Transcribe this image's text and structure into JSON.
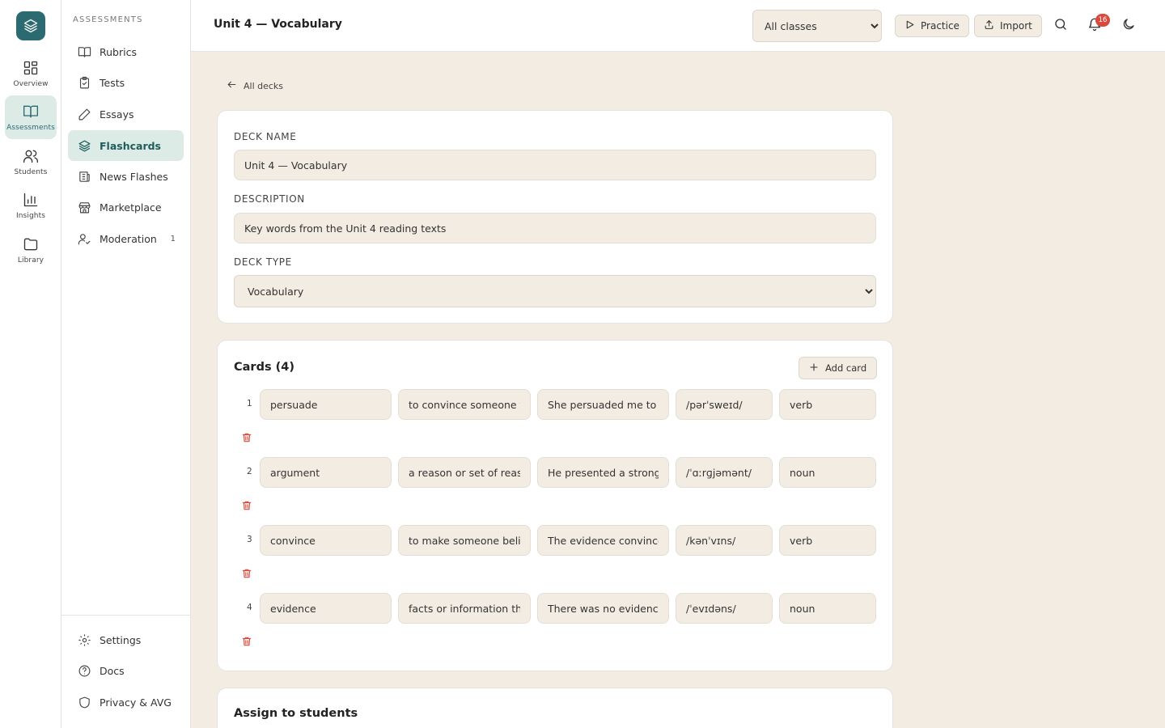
{
  "app": {
    "nav_rail": [
      {
        "label": "Overview",
        "icon": "grid-icon"
      },
      {
        "label": "Assessments",
        "icon": "book-icon"
      },
      {
        "label": "Students",
        "icon": "users-icon"
      },
      {
        "label": "Insights",
        "icon": "bar-chart-icon"
      },
      {
        "label": "Library",
        "icon": "folder-icon"
      }
    ]
  },
  "sidebar": {
    "heading": "ASSESSMENTS",
    "items": [
      {
        "label": "Rubrics",
        "icon": "book-open-icon"
      },
      {
        "label": "Tests",
        "icon": "clipboard-check-icon"
      },
      {
        "label": "Essays",
        "icon": "pen-icon"
      },
      {
        "label": "Flashcards",
        "icon": "layers-icon"
      },
      {
        "label": "News Flashes",
        "icon": "newspaper-icon"
      },
      {
        "label": "Marketplace",
        "icon": "store-icon"
      },
      {
        "label": "Moderation",
        "icon": "user-check-icon",
        "count": "1"
      }
    ],
    "footer": [
      {
        "label": "Settings",
        "icon": "gear-icon"
      },
      {
        "label": "Docs",
        "icon": "help-circle-icon"
      },
      {
        "label": "Privacy & AVG",
        "icon": "shield-icon"
      }
    ]
  },
  "header": {
    "title": "Unit 4 — Vocabulary",
    "class_filter": {
      "selected": "All classes"
    },
    "practice_label": "Practice",
    "import_label": "Import",
    "notification_count": "16"
  },
  "back_link": "All decks",
  "deck": {
    "name_label": "DECK NAME",
    "name_value": "Unit 4 — Vocabulary",
    "description_label": "DESCRIPTION",
    "description_value": "Key words from the Unit 4 reading texts",
    "type_label": "DECK TYPE",
    "type_selected": "Vocabulary"
  },
  "cards": {
    "title": "Cards (4)",
    "add_label": "Add card",
    "rows": [
      {
        "num": "1",
        "term": "persuade",
        "definition": "to convince someone t",
        "example": "She persuaded me to j",
        "pronunciation": "/pərˈsweɪd/",
        "pos": "verb"
      },
      {
        "num": "2",
        "term": "argument",
        "definition": "a reason or set of reas",
        "example": "He presented a strong",
        "pronunciation": "/ˈɑːrɡjəmənt/",
        "pos": "noun"
      },
      {
        "num": "3",
        "term": "convince",
        "definition": "to make someone belie",
        "example": "The evidence convince",
        "pronunciation": "/kənˈvɪns/",
        "pos": "verb"
      },
      {
        "num": "4",
        "term": "evidence",
        "definition": "facts or information th",
        "example": "There was no evidence",
        "pronunciation": "/ˈevɪdəns/",
        "pos": "noun"
      }
    ]
  },
  "assign": {
    "title": "Assign to students"
  },
  "colors": {
    "accent": "#2c6a72",
    "active_bg": "#dcebe6",
    "page_bg": "#f3ece3",
    "danger": "#d94a3d"
  }
}
